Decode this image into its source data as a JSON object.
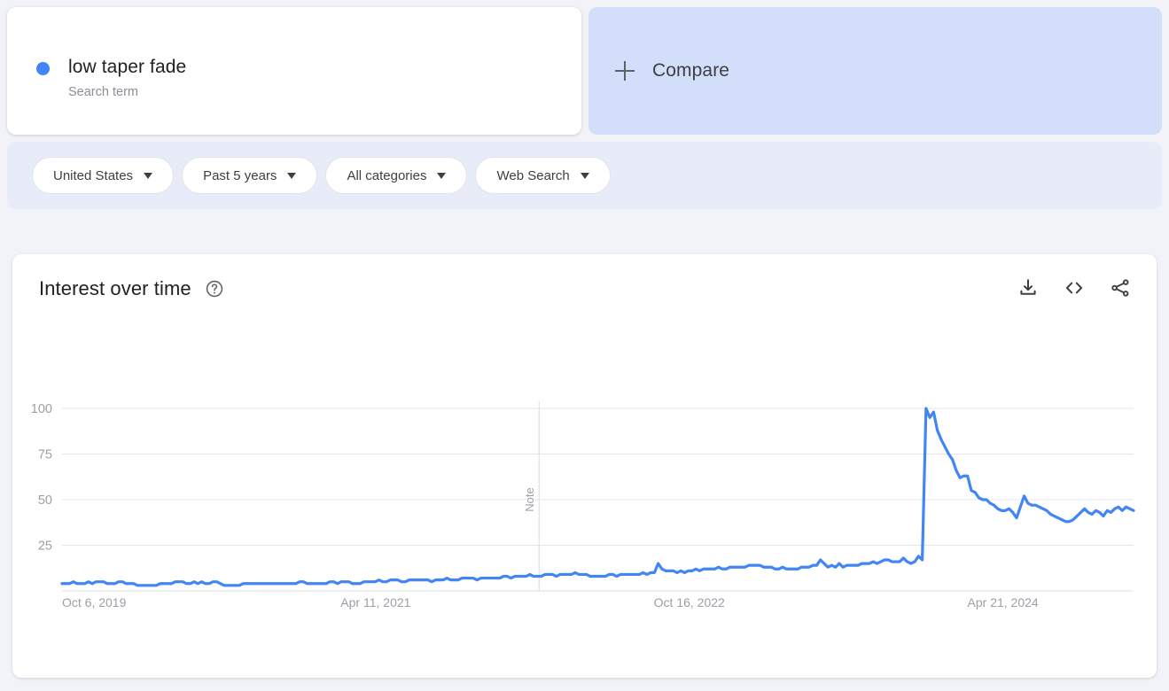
{
  "search_term": {
    "title": "low taper fade",
    "subtitle": "Search term",
    "dot_color": "#4285f4"
  },
  "compare": {
    "label": "Compare",
    "icon": "plus-icon"
  },
  "filters": [
    {
      "label": "United States",
      "name": "location-filter"
    },
    {
      "label": "Past 5 years",
      "name": "time-range-filter"
    },
    {
      "label": "All categories",
      "name": "category-filter"
    },
    {
      "label": "Web Search",
      "name": "search-type-filter"
    }
  ],
  "chart_card": {
    "title": "Interest over time",
    "help_icon": "help-circle-icon",
    "tools": [
      {
        "name": "download-icon",
        "label": "Download"
      },
      {
        "name": "embed-code-icon",
        "label": "Embed"
      },
      {
        "name": "share-icon",
        "label": "Share"
      }
    ]
  },
  "chart_data": {
    "type": "line",
    "title": "Interest over time",
    "xlabel": "",
    "ylabel": "",
    "ylim": [
      0,
      100
    ],
    "yticks": [
      25,
      50,
      75,
      100
    ],
    "ytick_labels": [
      "25",
      "50",
      "75",
      "100"
    ],
    "xtick_labels": [
      "Oct 6, 2019",
      "Apr 11, 2021",
      "Oct 16, 2022",
      "Apr 21, 2024"
    ],
    "xtick_positions": [
      0.0,
      0.2927,
      0.5854,
      0.8781
    ],
    "grid": true,
    "legend_position": "top-card",
    "line_color": "#4285f4",
    "line_width": 3.2,
    "annotations": [
      {
        "label": "Note",
        "x_fraction": 0.4452,
        "orientation": "vertical",
        "color": "#9aa0a6"
      }
    ],
    "series": [
      {
        "name": "low taper fade",
        "color": "#4285f4",
        "values": [
          4,
          4,
          4,
          5,
          4,
          4,
          4,
          5,
          4,
          5,
          5,
          5,
          4,
          4,
          4,
          5,
          5,
          4,
          4,
          4,
          3,
          3,
          3,
          3,
          3,
          3,
          4,
          4,
          4,
          4,
          5,
          5,
          5,
          4,
          4,
          5,
          4,
          5,
          4,
          4,
          5,
          5,
          4,
          3,
          3,
          3,
          3,
          3,
          4,
          4,
          4,
          4,
          4,
          4,
          4,
          4,
          4,
          4,
          4,
          4,
          4,
          4,
          4,
          5,
          5,
          4,
          4,
          4,
          4,
          4,
          4,
          5,
          5,
          4,
          5,
          5,
          5,
          4,
          4,
          4,
          5,
          5,
          5,
          5,
          6,
          5,
          5,
          6,
          6,
          6,
          5,
          5,
          6,
          6,
          6,
          6,
          6,
          6,
          5,
          6,
          6,
          6,
          7,
          6,
          6,
          6,
          7,
          7,
          7,
          7,
          6,
          7,
          7,
          7,
          7,
          7,
          7,
          8,
          8,
          7,
          8,
          8,
          8,
          8,
          9,
          8,
          8,
          8,
          9,
          9,
          9,
          8,
          9,
          9,
          9,
          9,
          10,
          9,
          9,
          9,
          8,
          8,
          8,
          8,
          8,
          9,
          9,
          8,
          9,
          9,
          9,
          9,
          9,
          9,
          10,
          9,
          10,
          10,
          15,
          12,
          11,
          11,
          11,
          10,
          11,
          10,
          11,
          11,
          12,
          11,
          12,
          12,
          12,
          12,
          13,
          12,
          12,
          13,
          13,
          13,
          13,
          13,
          14,
          14,
          14,
          14,
          13,
          13,
          13,
          12,
          12,
          13,
          12,
          12,
          12,
          12,
          13,
          13,
          13,
          14,
          14,
          17,
          15,
          13,
          14,
          13,
          15,
          13,
          14,
          14,
          14,
          14,
          15,
          15,
          15,
          16,
          15,
          16,
          17,
          17,
          16,
          16,
          16,
          18,
          16,
          15,
          16,
          19,
          17,
          100,
          95,
          98,
          88,
          83,
          79,
          75,
          72,
          66,
          62,
          63,
          63,
          55,
          54,
          51,
          50,
          50,
          48,
          47,
          45,
          44,
          44,
          45,
          43,
          40,
          46,
          52,
          48,
          47,
          47,
          46,
          45,
          44,
          42,
          41,
          40,
          39,
          38,
          38,
          39,
          41,
          43,
          45,
          43,
          42,
          44,
          43,
          41,
          44,
          43,
          45,
          46,
          44,
          46,
          45,
          44
        ]
      }
    ]
  }
}
